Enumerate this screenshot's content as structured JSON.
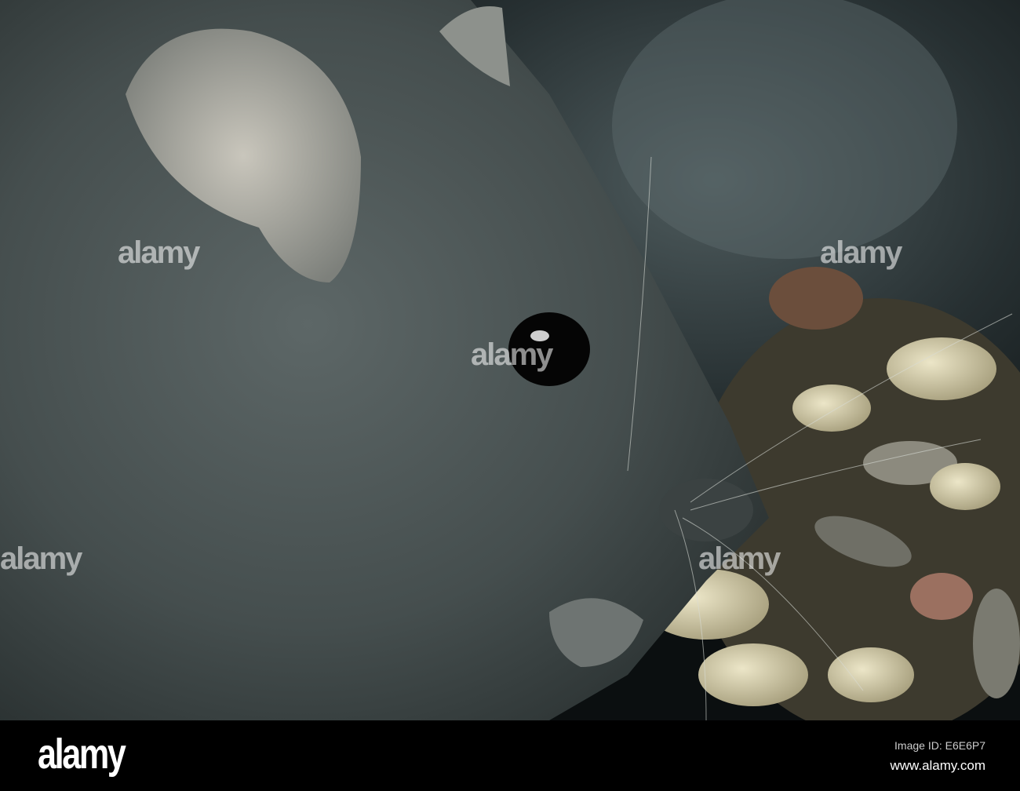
{
  "photo": {
    "subject": "black rat eating seeds"
  },
  "watermark": {
    "text": "alamy"
  },
  "footer": {
    "logo": "alamy",
    "image_id": "Image ID: E6E6P7",
    "website": "www.alamy.com"
  },
  "colors": {
    "fur": "#4a5252",
    "background": "#0e1212",
    "seeds": "#d8d2b0"
  }
}
